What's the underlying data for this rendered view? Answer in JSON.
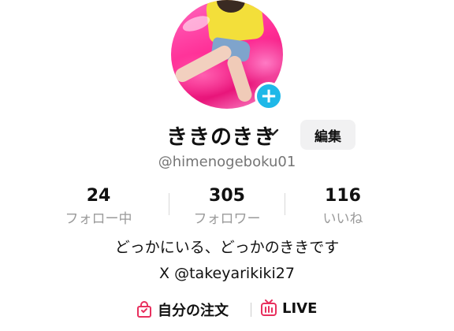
{
  "profile": {
    "display_name": "きき",
    "display_name_full": "ききのきき",
    "username": "@himenogeboku01",
    "edit_label": "編集"
  },
  "stats": [
    {
      "value": "24",
      "label": "フォロー中"
    },
    {
      "value": "305",
      "label": "フォロワー"
    },
    {
      "value": "116",
      "label": "いいね"
    }
  ],
  "bio": {
    "line1": "どっかにいる、どっかのききです",
    "line2": "X @takeyarikiki27"
  },
  "links": {
    "orders_label": "自分の注文",
    "live_label": "LIVE"
  },
  "icons": {
    "add_badge": "plus-icon",
    "dropdown": "chevron-down-icon",
    "orders": "shopping-bag-icon",
    "live": "live-tv-icon"
  },
  "colors": {
    "accent_badge": "#1fb8e8",
    "icon_pink": "#e8305e"
  }
}
